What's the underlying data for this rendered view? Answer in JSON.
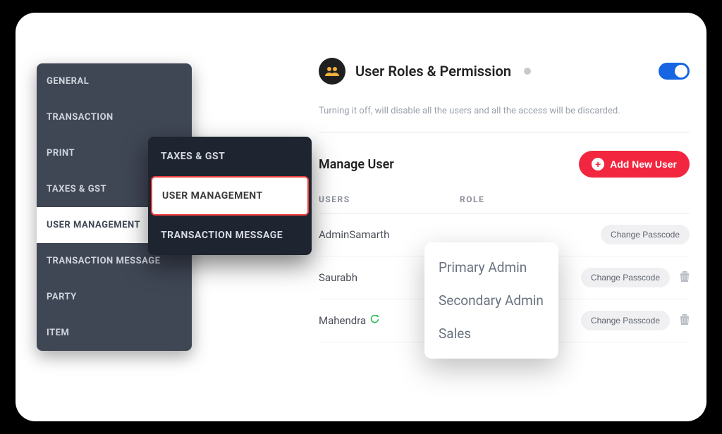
{
  "sidebar1": {
    "items": [
      {
        "label": "GENERAL"
      },
      {
        "label": "TRANSACTION"
      },
      {
        "label": "PRINT"
      },
      {
        "label": "TAXES & GST"
      },
      {
        "label": "USER MANAGEMENT"
      },
      {
        "label": "TRANSACTION MESSAGE"
      },
      {
        "label": "PARTY"
      },
      {
        "label": "ITEM"
      }
    ]
  },
  "sidebar2": {
    "items": [
      {
        "label": "TAXES & GST"
      },
      {
        "label": "USER MANAGEMENT"
      },
      {
        "label": "TRANSACTION MESSAGE"
      }
    ]
  },
  "header": {
    "title": "User Roles & Permission",
    "subtext": "Turning it off, will disable all the users and all the access will be discarded."
  },
  "manage": {
    "title": "Manage User",
    "add_label": "Add New User"
  },
  "table": {
    "head_user": "USERS",
    "head_role": "ROLE",
    "change_label": "Change Passcode",
    "rows": [
      {
        "user": "AdminSamarth"
      },
      {
        "user": "Saurabh"
      },
      {
        "user": "Mahendra"
      }
    ]
  },
  "role_popup": {
    "options": [
      {
        "label": "Primary Admin"
      },
      {
        "label": "Secondary Admin"
      },
      {
        "label": "Sales"
      }
    ]
  }
}
